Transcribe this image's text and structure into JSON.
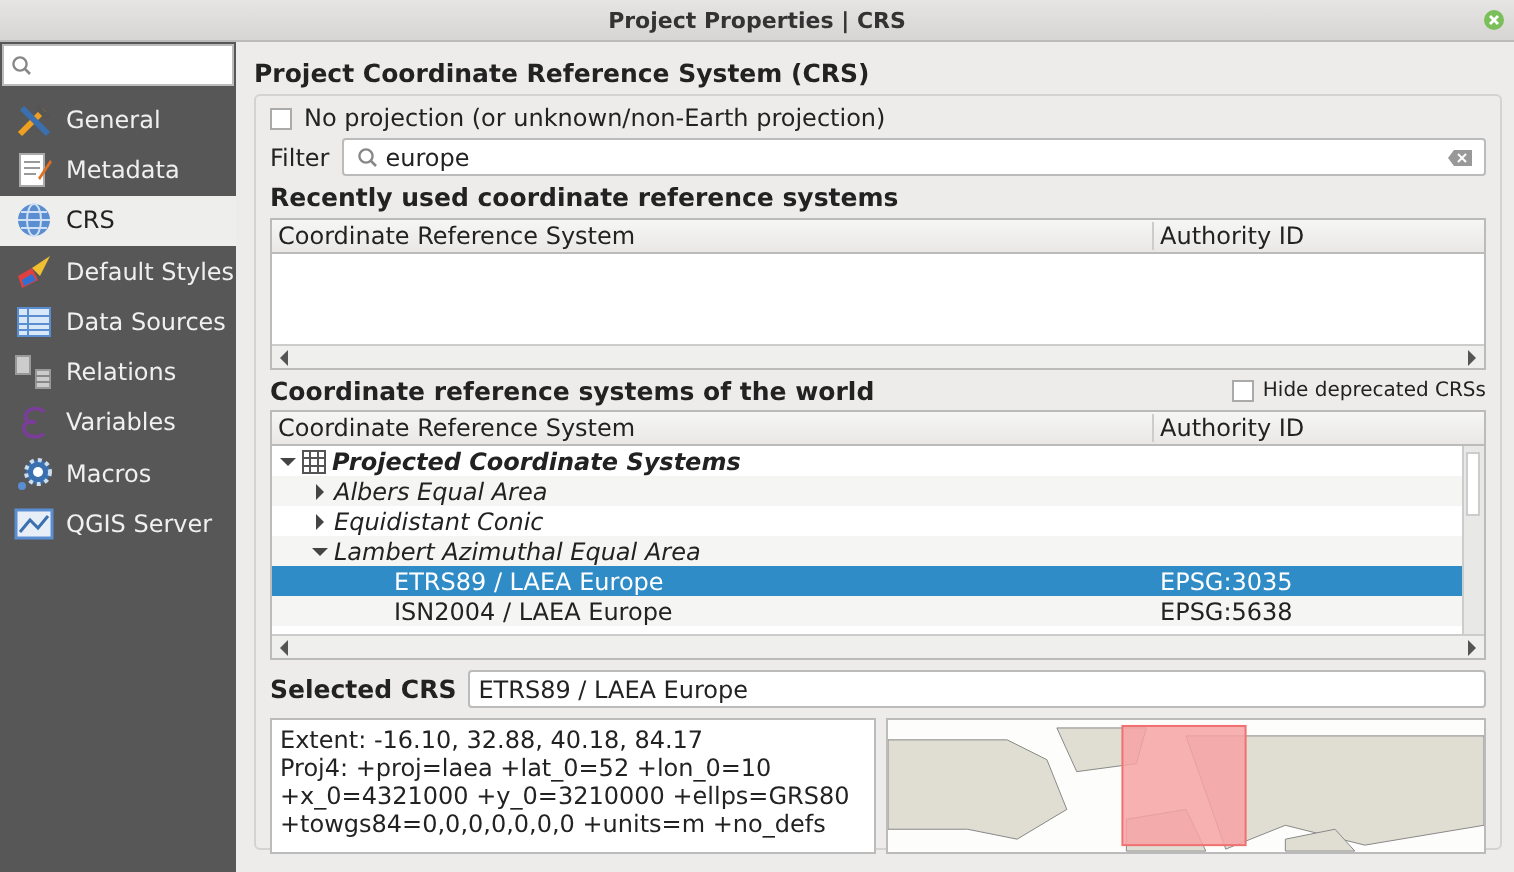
{
  "window": {
    "title": "Project Properties | CRS"
  },
  "sidebar": {
    "items": [
      {
        "label": "General",
        "selected": false
      },
      {
        "label": "Metadata",
        "selected": false
      },
      {
        "label": "CRS",
        "selected": true
      },
      {
        "label": "Default Styles",
        "selected": false
      },
      {
        "label": "Data Sources",
        "selected": false
      },
      {
        "label": "Relations",
        "selected": false
      },
      {
        "label": "Variables",
        "selected": false
      },
      {
        "label": "Macros",
        "selected": false
      },
      {
        "label": "QGIS Server",
        "selected": false
      }
    ]
  },
  "page": {
    "heading": "Project Coordinate Reference System (CRS)",
    "no_projection": {
      "label": "No projection (or unknown/non-Earth projection)",
      "checked": false
    },
    "filter": {
      "label": "Filter",
      "value": "europe"
    },
    "recent": {
      "heading": "Recently used coordinate reference systems",
      "columns": [
        "Coordinate Reference System",
        "Authority ID"
      ]
    },
    "world": {
      "heading": "Coordinate reference systems of the world",
      "hide_deprecated": {
        "label": "Hide deprecated CRSs",
        "checked": false
      },
      "columns": [
        "Coordinate Reference System",
        "Authority ID"
      ],
      "tree": [
        {
          "kind": "group",
          "label": "Projected Coordinate Systems",
          "expanded": true,
          "children": [
            {
              "kind": "projection",
              "label": "Albers Equal Area",
              "expanded": false
            },
            {
              "kind": "projection",
              "label": "Equidistant Conic",
              "expanded": false
            },
            {
              "kind": "projection",
              "label": "Lambert Azimuthal Equal Area",
              "expanded": true,
              "children": [
                {
                  "kind": "crs",
                  "label": "ETRS89 / LAEA Europe",
                  "authority": "EPSG:3035",
                  "selected": true
                },
                {
                  "kind": "crs",
                  "label": "ISN2004 / LAEA Europe",
                  "authority": "EPSG:5638",
                  "selected": false
                }
              ]
            }
          ]
        }
      ]
    },
    "selected_crs": {
      "label": "Selected CRS",
      "value": "ETRS89 / LAEA Europe"
    },
    "details": [
      "Extent: -16.10, 32.88, 40.18, 84.17",
      "Proj4: +proj=laea +lat_0=52 +lon_0=10",
      "+x_0=4321000 +y_0=3210000 +ellps=GRS80",
      "+towgs84=0,0,0,0,0,0,0 +units=m +no_defs"
    ]
  }
}
